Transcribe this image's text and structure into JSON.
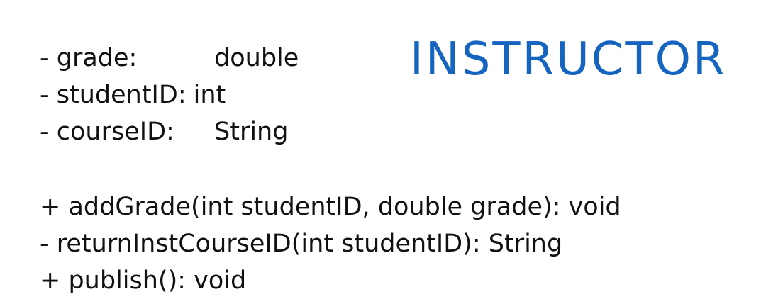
{
  "colors": {
    "class_name": "#1565c0",
    "text": "#111111",
    "background": "#ffffff"
  },
  "class_name": "INSTRUCTOR",
  "attributes": [
    {
      "name": "- grade:",
      "type": "double"
    },
    {
      "name": "- studentID:",
      "type": "int"
    },
    {
      "name": "- courseID:",
      "type": "String"
    }
  ],
  "operations": [
    "+ addGrade(int studentID, double grade): void",
    "- returnInstCourseID(int studentID): String",
    "+ publish(): void"
  ]
}
